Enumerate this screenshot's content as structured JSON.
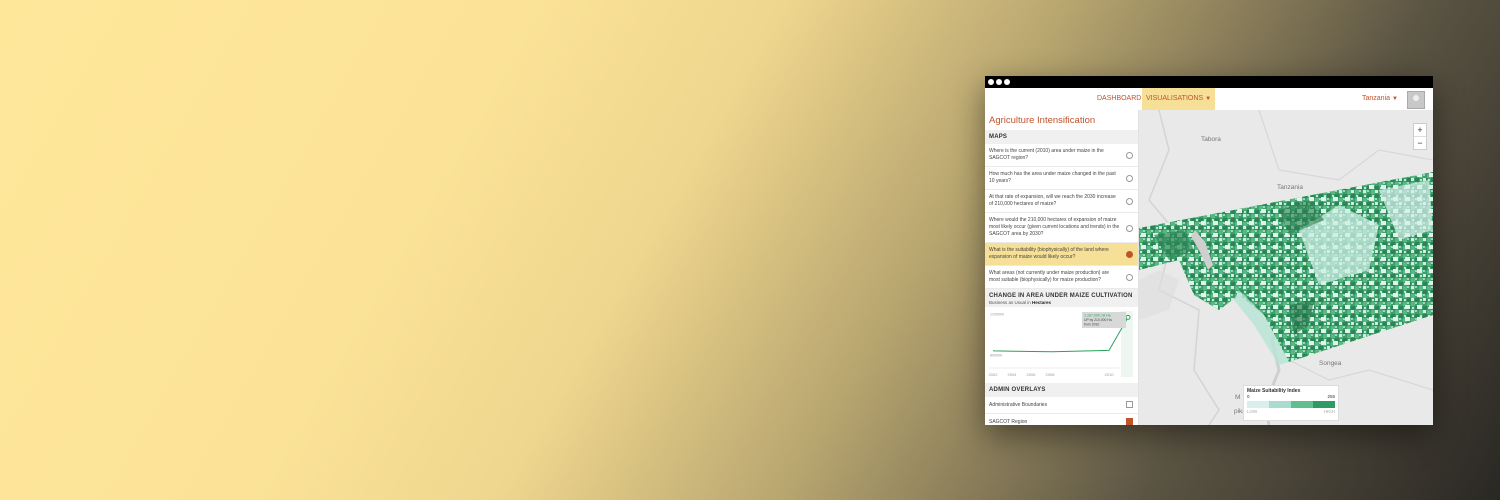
{
  "window": {
    "nav": {
      "dashboard": "DASHBOARD",
      "visualisations": "VISUALISATIONS",
      "country": "Tanzania"
    },
    "app_title": "Agriculture Intensification",
    "maps_header": "MAPS",
    "questions": [
      {
        "text": "Where is the current (2010) area under maize in the SAGCOT region?",
        "selected": false
      },
      {
        "text": "How much has the area under maize changed in the past 10 years?",
        "selected": false
      },
      {
        "text": "At that rate of expansion, will we reach the 2030 increase of 210,000 hectares of maize?",
        "selected": false
      },
      {
        "text": "Where would the 210,000 hectares of expansion of maize most likely occur (given current locations and trends) in the SAGCOT area by 2030?",
        "selected": false
      },
      {
        "text": "What is the suitability (biophysically) of the land where expansion of maize would likely occur?",
        "selected": true
      },
      {
        "text": "What areas (not currently under maize production) are most suitable (biophysically) for maize production?",
        "selected": false
      }
    ],
    "chart": {
      "header": "CHANGE IN AREA UNDER MAIZE CULTIVATION",
      "sub_prefix": "Business as Usual in ",
      "sub_bold": "Hectares",
      "tooltip": {
        "line1": "1,167,000.18 Ha",
        "line2_prefix": "UP by ",
        "line2_bold": "210,000 Ha",
        "line3_prefix": "from ",
        "line3_bold": "2010"
      }
    },
    "overlays_header": "ADMIN OVERLAYS",
    "overlays": [
      {
        "label": "Administrative Boundaries",
        "checked": false
      },
      {
        "label": "SAGCOT Region",
        "checked": true
      }
    ],
    "map": {
      "labels": {
        "tabora": "Tabora",
        "tanzania": "Tanzania",
        "songea": "Songea",
        "m": "M",
        "pika": "pika"
      },
      "zoom_in": "+",
      "zoom_out": "−",
      "legend": {
        "title": "Maize Suitability Index",
        "min": "0",
        "max": "255",
        "low": "LOW",
        "high": "HIGH",
        "colors": [
          "#d8efec",
          "#a9dcd0",
          "#5fbf93",
          "#2f9a63"
        ]
      }
    }
  },
  "chart_data": {
    "type": "line",
    "title": "CHANGE IN AREA UNDER MAIZE CULTIVATION",
    "subtitle": "Business as Usual in Hectares",
    "x_ticks": [
      "2002",
      "2004",
      "2006",
      "2008",
      "2010",
      "2030"
    ],
    "y_ticks": [
      "1200000",
      "800000"
    ],
    "series": [
      {
        "x": [
          "2000",
          "2002",
          "2004",
          "2006",
          "2008",
          "2010",
          "2030"
        ],
        "values": [
          840000,
          838000,
          835000,
          832000,
          830000,
          843000,
          1167000
        ]
      }
    ],
    "ylim": [
      680000,
      1230000
    ],
    "grid": false,
    "colors": [
      "#2aa25a"
    ]
  }
}
